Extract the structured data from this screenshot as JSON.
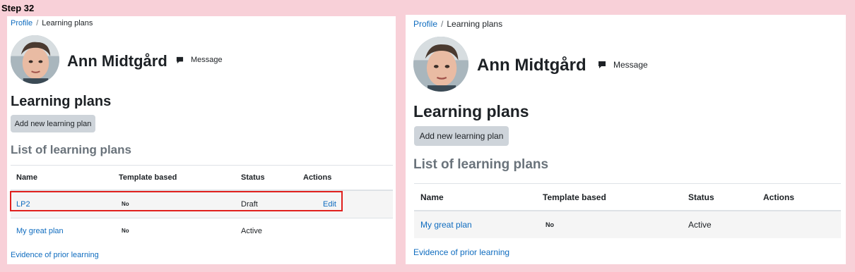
{
  "step_label": "Step 32",
  "breadcrumb": {
    "profile": "Profile",
    "separator": "/",
    "current": "Learning plans"
  },
  "user": {
    "name": "Ann Midtgård",
    "message_label": "Message"
  },
  "page_heading": "Learning plans",
  "add_button": "Add new learning plan",
  "list_heading": "List of learning plans",
  "columns": {
    "name": "Name",
    "template": "Template based",
    "status": "Status",
    "actions": "Actions"
  },
  "left_rows": [
    {
      "name": "LP2",
      "template": "No",
      "status": "Draft",
      "action": "Edit"
    },
    {
      "name": "My great plan",
      "template": "No",
      "status": "Active",
      "action": ""
    }
  ],
  "right_rows": [
    {
      "name": "My great plan",
      "template": "No",
      "status": "Active",
      "action": ""
    }
  ],
  "evidence_link": "Evidence of prior learning",
  "icons": {
    "message": "message-icon",
    "avatar": "user-avatar"
  },
  "colors": {
    "link": "#0f6cbf",
    "highlight": "#e0201d",
    "background": "#f8d0d8"
  }
}
